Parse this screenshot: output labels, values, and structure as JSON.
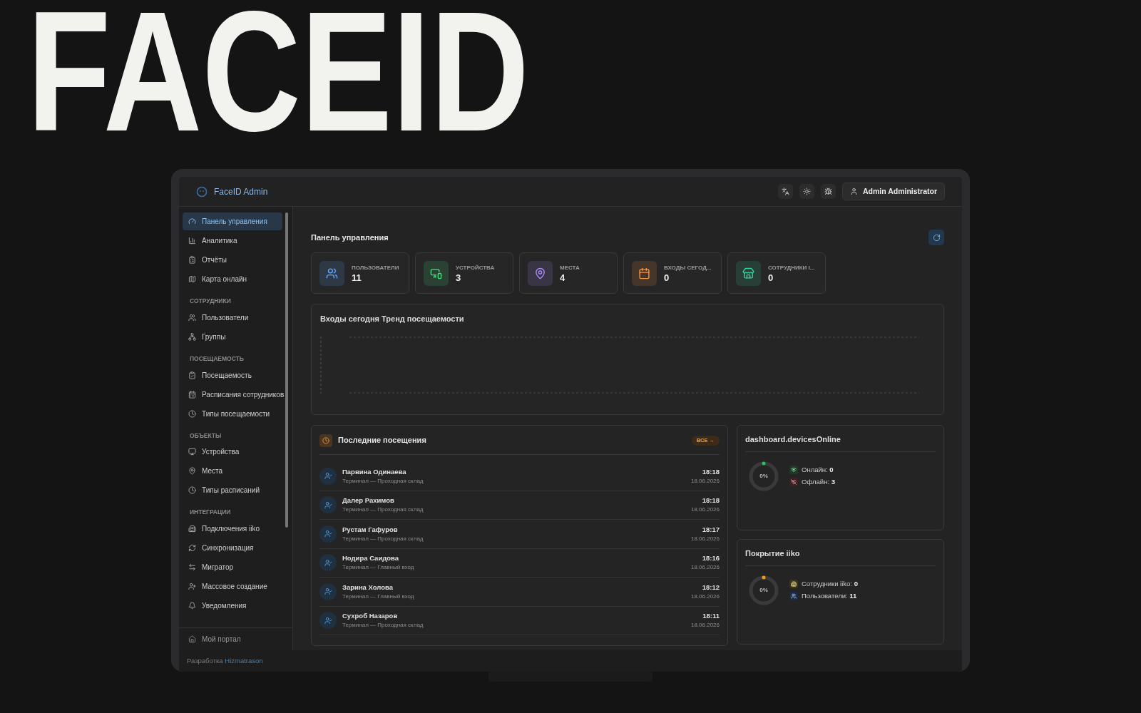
{
  "headline": "FACEID",
  "app": {
    "name": "FaceID Admin",
    "user": "Admin Administrator"
  },
  "sidebar": {
    "sections": [
      {
        "items": [
          {
            "label": "Панель управления",
            "selected": true
          },
          {
            "label": "Аналитика",
            "selected": false
          },
          {
            "label": "Отчёты",
            "selected": false
          },
          {
            "label": "Карта онлайн",
            "selected": false
          }
        ]
      },
      {
        "title": "СОТРУДНИКИ",
        "items": [
          {
            "label": "Пользователи",
            "selected": false
          },
          {
            "label": "Группы",
            "selected": false
          }
        ]
      },
      {
        "title": "ПОСЕЩАЕМОСТЬ",
        "items": [
          {
            "label": "Посещаемость",
            "selected": false
          },
          {
            "label": "Расписания сотрудников",
            "selected": false
          },
          {
            "label": "Типы посещаемости",
            "selected": false
          }
        ]
      },
      {
        "title": "ОБЪЕКТЫ",
        "items": [
          {
            "label": "Устройства",
            "selected": false
          },
          {
            "label": "Места",
            "selected": false
          },
          {
            "label": "Типы расписаний",
            "selected": false
          }
        ]
      },
      {
        "title": "ИНТЕГРАЦИИ",
        "items": [
          {
            "label": "Подключения iiko",
            "selected": false
          },
          {
            "label": "Синхронизация",
            "selected": false
          },
          {
            "label": "Мигратор",
            "selected": false
          },
          {
            "label": "Массовое создание",
            "selected": false
          },
          {
            "label": "Уведомления",
            "selected": false
          }
        ]
      }
    ],
    "portal": "Мой портал"
  },
  "page_title": "Панель управления",
  "stats": [
    {
      "label": "ПОЛЬЗОВАТЕЛИ",
      "value": "11",
      "color": "#60a5fa"
    },
    {
      "label": "УСТРОЙСТВА",
      "value": "3",
      "color": "#4ade80"
    },
    {
      "label": "МЕСТА",
      "value": "4",
      "color": "#a78bfa"
    },
    {
      "label": "ВХОДЫ СЕГОД...",
      "value": "0",
      "color": "#fb923c"
    },
    {
      "label": "СОТРУДНИКИ I...",
      "value": "0",
      "color": "#34d399"
    }
  ],
  "trend": {
    "title": "Входы сегодня Тренд посещаемости"
  },
  "visits": {
    "title": "Последние посещения",
    "all_button": "ВСЕ →",
    "rows": [
      {
        "name": "Парвина Одинаева",
        "place": "Терминал — Проходная склад",
        "time": "18:18",
        "date": "18.06.2026"
      },
      {
        "name": "Далер Рахимов",
        "place": "Терминал — Проходная склад",
        "time": "18:18",
        "date": "18.06.2026"
      },
      {
        "name": "Рустам Гафуров",
        "place": "Терминал — Проходная склад",
        "time": "18:17",
        "date": "18.06.2026"
      },
      {
        "name": "Нодира Саидова",
        "place": "Терминал — Главный вход",
        "time": "18:16",
        "date": "18.06.2026"
      },
      {
        "name": "Зарина Холова",
        "place": "Терминал — Главный вход",
        "time": "18:12",
        "date": "18.06.2026"
      },
      {
        "name": "Сухроб Назаров",
        "place": "Терминал — Проходная склад",
        "time": "18:11",
        "date": "18.06.2026"
      }
    ]
  },
  "gauges": [
    {
      "title": "dashboard.devicesOnline",
      "percent": "0%",
      "color": "#22c55e",
      "legend": [
        {
          "label": "Онлайн:",
          "value": "0",
          "color": "#1d3b27"
        },
        {
          "label": "Офлайн:",
          "value": "3",
          "color": "#3d2024"
        }
      ]
    },
    {
      "title": "Покрытие iiko",
      "percent": "0%",
      "color": "#f59e0b",
      "legend": [
        {
          "label": "Сотрудники iiko:",
          "value": "0",
          "color": "#3b3419"
        },
        {
          "label": "Пользователи:",
          "value": "11",
          "color": "#1c2c40"
        }
      ]
    }
  ],
  "footer": {
    "text": "Разработка",
    "link": "Hizmatrason"
  }
}
